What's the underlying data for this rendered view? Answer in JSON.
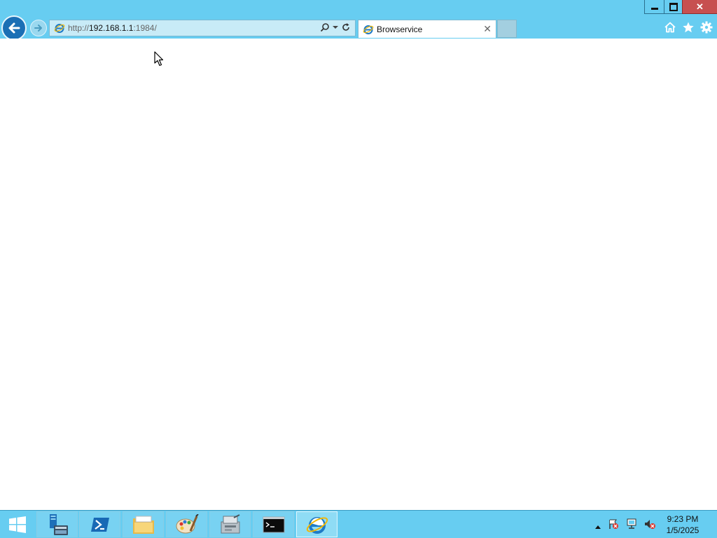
{
  "browser": {
    "address_bar": {
      "url_protocol": "http://",
      "url_host": "192.168.1.1",
      "url_port": ":1984/"
    },
    "tab": {
      "title": "Browservice",
      "close_glyph": "✕"
    },
    "window_controls": {
      "close_glyph": "✕"
    },
    "icons": [
      "back-arrow-icon",
      "forward-arrow-icon",
      "ie-logo-icon",
      "search-icon",
      "dropdown-arrow-icon",
      "refresh-icon",
      "home-icon",
      "favorites-star-icon",
      "settings-gear-icon"
    ]
  },
  "taskbar": {
    "items": [
      "windows-start",
      "server-manager",
      "powershell",
      "file-explorer",
      "paint",
      "tools",
      "command-prompt",
      "internet-explorer"
    ],
    "tray_icons": [
      "show-hidden-icons",
      "action-center-flag",
      "network",
      "volume-muted"
    ],
    "clock": {
      "time": "9:23 PM",
      "date": "1/5/2025"
    }
  },
  "colors": {
    "chrome_bg": "#67cdf1",
    "close_button": "#c75050",
    "back_button": "#1b6fb5"
  }
}
